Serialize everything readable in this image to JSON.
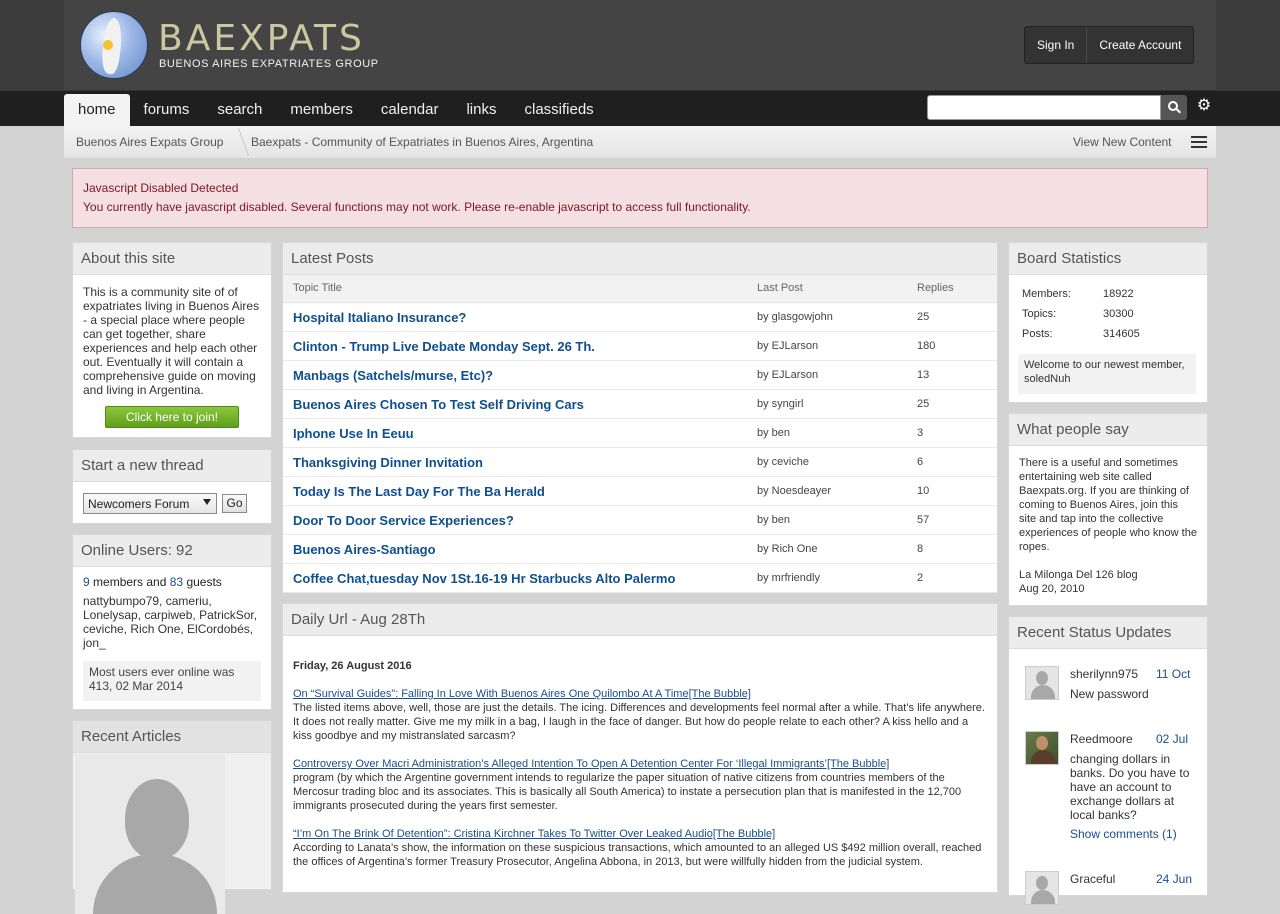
{
  "header": {
    "logo_title": "BAEXPATS",
    "logo_subtitle": "BUENOS AIRES EXPATRIATES GROUP",
    "sign_in": "Sign In",
    "create_account": "Create Account"
  },
  "nav": {
    "tabs": [
      "home",
      "forums",
      "search",
      "members",
      "calendar",
      "links",
      "classifieds"
    ],
    "active": "home",
    "search_placeholder": ""
  },
  "breadcrumb": {
    "items": [
      "Buenos Aires Expats Group",
      "Baexpats - Community of Expatriates in Buenos Aires, Argentina"
    ],
    "view_new": "View New Content"
  },
  "alert": {
    "title": "Javascript Disabled Detected",
    "message": "You currently have javascript disabled. Several functions may not work. Please re-enable javascript to access full functionality."
  },
  "about": {
    "title": "About this site",
    "text": "This is a community site of of expatriates living in Buenos Aires - a special place where people can get together, share experiences and help each other out. Eventually it will contain a comprehensive guide on moving and living in Argentina.",
    "join": "Click here to join!"
  },
  "new_thread": {
    "title": "Start a new thread",
    "forum": "Newcomers Forum",
    "go": "Go"
  },
  "online": {
    "title": "Online Users: 92",
    "members_count": "9",
    "members_label": "members and",
    "guests_count": "83",
    "guests_label": "guests",
    "names": "nattybumpo79, cameriu, Lonelysap, carpiweb, PatrickSor, ceviche, Rich One, ElCordobés, jon_",
    "most": "Most users ever online was 413, 02 Mar 2014"
  },
  "recent_articles": {
    "title": "Recent Articles"
  },
  "latest_posts": {
    "title": "Latest Posts",
    "col_topic": "Topic Title",
    "col_last": "Last Post",
    "col_replies": "Replies",
    "rows": [
      {
        "title": "Hospital Italiano Insurance?",
        "last": "by glasgowjohn",
        "replies": "25"
      },
      {
        "title": "Clinton - Trump Live Debate Monday Sept. 26 Th.",
        "last": "by EJLarson",
        "replies": "180"
      },
      {
        "title": "Manbags (Satchels/murse, Etc)?",
        "last": "by EJLarson",
        "replies": "13"
      },
      {
        "title": "Buenos Aires Chosen To Test Self Driving Cars",
        "last": "by syngirl",
        "replies": "25"
      },
      {
        "title": "Iphone Use In Eeuu",
        "last": "by ben",
        "replies": "3"
      },
      {
        "title": "Thanksgiving Dinner Invitation",
        "last": "by ceviche",
        "replies": "6"
      },
      {
        "title": "Today Is The Last Day For The Ba Herald",
        "last": "by Noesdeayer",
        "replies": "10"
      },
      {
        "title": "Door To Door Service Experiences?",
        "last": "by ben",
        "replies": "57"
      },
      {
        "title": "Buenos Aires-Santiago",
        "last": "by Rich One",
        "replies": "8"
      },
      {
        "title": "Coffee Chat,tuesday Nov 1St.16-19 Hr Starbucks Alto Palermo",
        "last": "by mrfriendly",
        "replies": "2"
      }
    ]
  },
  "daily_url": {
    "title": "Daily Url - Aug 28Th",
    "date": "Friday, 26 August 2016",
    "items": [
      {
        "link": "On “Survival Guides”: Falling In Love With Buenos Aires One Quilombo At A Time[The Bubble]",
        "text": "The listed items above, well, those are just the details. The icing. Differences and developments feel normal after a while. That’s life anywhere. It does not really matter. Give me my milk in a bag, I laugh in the face of danger. But how do people relate to each other? A kiss hello and a kiss goodbye and my mistranslated sarcasm?"
      },
      {
        "link": "Controversy Over Macri Administration’s Alleged Intention To Open A Detention Center For ‘Illegal Immigrants’[The Bubble]",
        "text": "program (by which the Argentine government intends to regularize the paper situation of native citizens from countries members of the Mercosur trading bloc and its associates. This is basically all South America) to instate a persecution plan that is manifested in the 12,700 immigrants prosecuted during the years first semester."
      },
      {
        "link": "“I’m On The Brink Of Detention”: Cristina Kirchner Takes To Twitter Over Leaked Audio[The Bubble]",
        "text": "According to Lanata’s show, the information on these suspicious transactions, which amounted to an alleged US $492 million overall, reached the offices of Argentina’s former Treasury Prosecutor, Angelina Abbona, in 2013, but were willfully hidden from the judicial system."
      }
    ]
  },
  "stats": {
    "title": "Board Statistics",
    "members_label": "Members:",
    "members": "18922",
    "topics_label": "Topics:",
    "topics": "30300",
    "posts_label": "Posts:",
    "posts": "314605",
    "welcome": "Welcome to our newest member, soledNuh"
  },
  "what_people_say": {
    "title": "What people say",
    "quote": "There is a useful and sometimes entertaining web site called Baexpats.org. If you are thinking of coming to Buenos Aires, join this site and tap into the collective experiences of people who know the ropes.",
    "source": "La Milonga Del 126 blog",
    "date": "Aug 20, 2010"
  },
  "status_updates": {
    "title": "Recent Status Updates",
    "items": [
      {
        "name": "sherilynn975",
        "date": "11 Oct",
        "text": "New password"
      },
      {
        "name": "Reedmoore",
        "date": "02 Jul",
        "text": "changing dollars in banks. Do you have to have an account to exchange dollars at local banks?",
        "more": "Show comments (1)"
      },
      {
        "name": "Graceful",
        "date": "24 Jun",
        "text": ""
      }
    ]
  }
}
